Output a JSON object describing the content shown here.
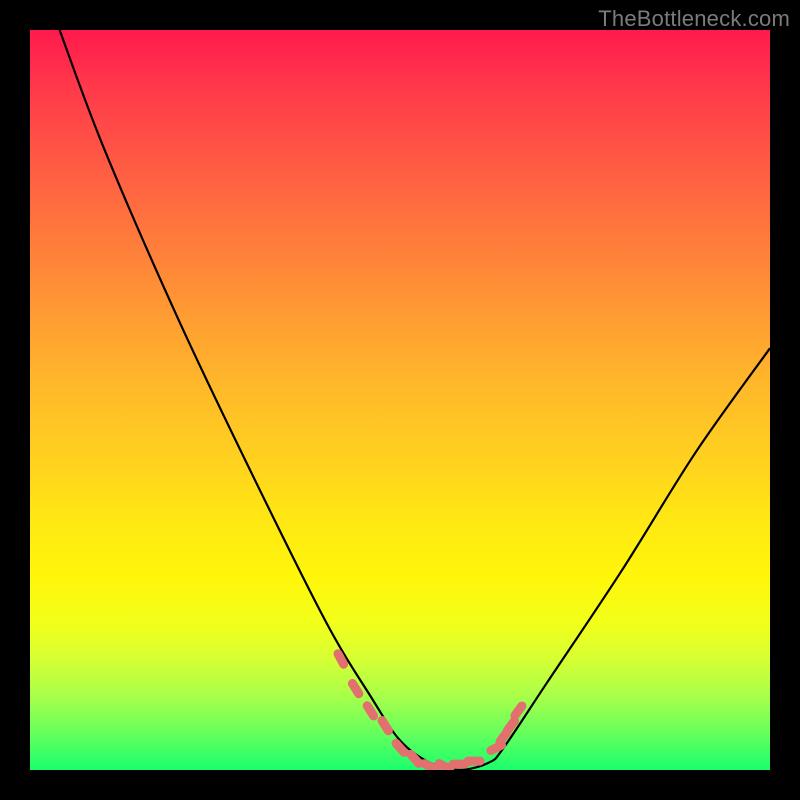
{
  "watermark": "TheBottleneck.com",
  "chart_data": {
    "type": "line",
    "title": "",
    "xlabel": "",
    "ylabel": "",
    "xlim": [
      0,
      100
    ],
    "ylim": [
      0,
      100
    ],
    "grid": false,
    "legend": false,
    "series": [
      {
        "name": "bottleneck-curve",
        "color": "#000000",
        "x": [
          4,
          10,
          20,
          30,
          40,
          46,
          50,
          54,
          58,
          62,
          64,
          70,
          80,
          90,
          100
        ],
        "values": [
          100,
          84,
          61,
          40,
          20,
          10,
          4,
          1,
          0,
          1,
          3,
          12,
          27,
          43,
          57
        ]
      }
    ],
    "markers": [
      {
        "name": "cluster-left",
        "color": "#e2706e",
        "x": [
          42,
          44,
          46,
          48
        ],
        "values": [
          15,
          11,
          8,
          6
        ]
      },
      {
        "name": "cluster-floor",
        "color": "#e2706e",
        "x": [
          50,
          52,
          54,
          56,
          58,
          60
        ],
        "values": [
          3,
          1.5,
          0.5,
          0.5,
          0.8,
          1.2
        ]
      },
      {
        "name": "cluster-right",
        "color": "#e2706e",
        "x": [
          63,
          64,
          65,
          66
        ],
        "values": [
          3,
          4.5,
          6,
          8
        ]
      }
    ],
    "gradient_stops": [
      {
        "pct": 0,
        "color": "#ff1a4d"
      },
      {
        "pct": 50,
        "color": "#ffd11f"
      },
      {
        "pct": 80,
        "color": "#fff60a"
      },
      {
        "pct": 100,
        "color": "#1aff6e"
      }
    ]
  }
}
